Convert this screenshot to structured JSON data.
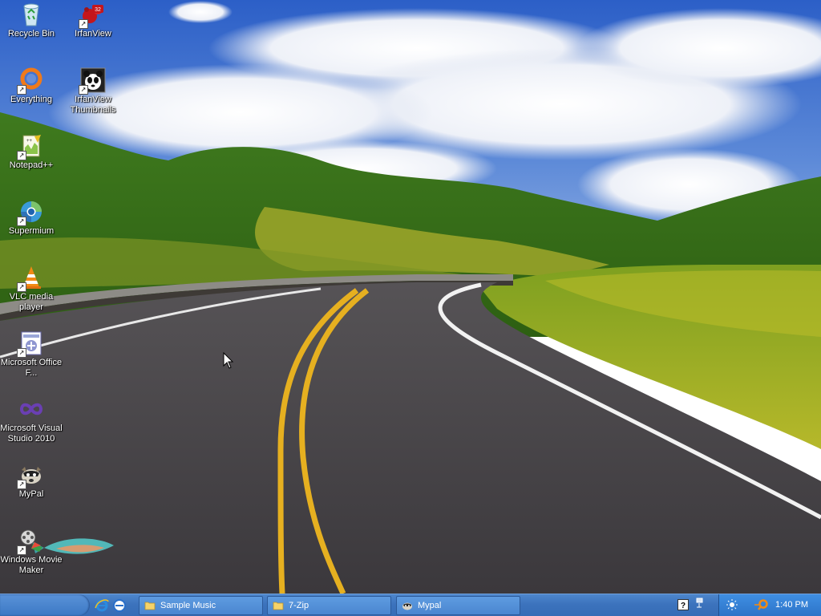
{
  "desktop": {
    "icons": [
      {
        "label": "Recycle Bin",
        "icon": "recycle-bin-icon",
        "shortcut": false
      },
      {
        "label": "IrfanView",
        "icon": "irfanview-icon",
        "shortcut": true,
        "badge": "32"
      },
      {
        "label": "Everything",
        "icon": "everything-icon",
        "shortcut": true
      },
      {
        "label": "IrfanView Thumbnails",
        "icon": "irfanview-thumbnails-icon",
        "shortcut": true
      },
      {
        "label": "Notepad++",
        "icon": "notepad-plus-plus-icon",
        "shortcut": true
      },
      {
        "label": "Supermium",
        "icon": "supermium-icon",
        "shortcut": true
      },
      {
        "label": "VLC media player",
        "icon": "vlc-icon",
        "shortcut": true
      },
      {
        "label": "Microsoft Office F...",
        "icon": "microsoft-office-icon",
        "shortcut": true
      },
      {
        "label": "Microsoft Visual Studio 2010",
        "icon": "visual-studio-icon",
        "shortcut": false
      },
      {
        "label": "MyPal",
        "icon": "mypal-icon",
        "shortcut": true
      },
      {
        "label": "Windows Movie Maker",
        "icon": "windows-movie-maker-icon",
        "shortcut": true
      }
    ]
  },
  "taskbar": {
    "quicklaunch": [
      "internet-explorer-icon",
      "show-desktop-icon"
    ],
    "tasks": [
      {
        "label": "Sample Music",
        "icon": "folder-icon",
        "active": false
      },
      {
        "label": "7-Zip",
        "icon": "folder-icon",
        "active": false
      },
      {
        "label": "Mypal",
        "icon": "mypal-icon",
        "active": false
      }
    ],
    "tray_icons": [
      "help-icon",
      "network-icon",
      "brightness-icon",
      "search-icon"
    ],
    "clock": "1:40 PM"
  },
  "colors": {
    "taskbar": "#3c73bd",
    "task_button": "#4a86d0",
    "tray": "#2d74c8"
  }
}
